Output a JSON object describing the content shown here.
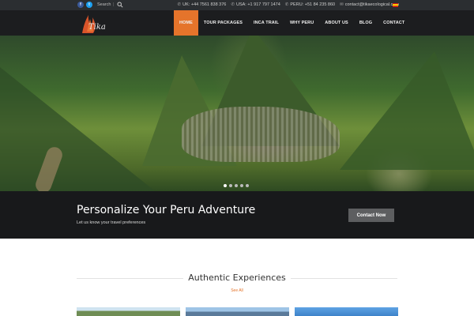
{
  "topbar": {
    "social": [
      "f",
      "t"
    ],
    "search_label": "Search",
    "contacts": [
      {
        "icon": "phone-icon",
        "text": "UK: +44 7561 838 376"
      },
      {
        "icon": "phone-icon",
        "text": "USA: +1 917 797 1474"
      },
      {
        "icon": "phone-icon",
        "text": "PERU: +51 84 235 860"
      },
      {
        "icon": "mail-icon",
        "text": "contact@tikaecological.com"
      }
    ],
    "flag_color": "#c60b1e"
  },
  "brand": {
    "logo_text": "Tika"
  },
  "nav": {
    "items": [
      "HOME",
      "TOUR PACKAGES",
      "INCA TRAIL",
      "WHY PERU",
      "ABOUT US",
      "BLOG",
      "CONTACT"
    ],
    "active_color": "#e5742b"
  },
  "hero": {
    "slides": 5,
    "active_slide": 1
  },
  "promo": {
    "title": "Personalize Your Peru Adventure",
    "subtitle": "Let us know your travel preferences",
    "cta": "Contact Now"
  },
  "section": {
    "title": "Authentic Experiences",
    "see_all": "See All"
  }
}
